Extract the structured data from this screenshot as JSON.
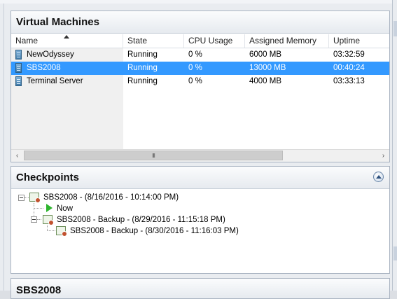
{
  "vm_panel": {
    "title": "Virtual Machines",
    "columns": [
      "Name",
      "State",
      "CPU Usage",
      "Assigned Memory",
      "Uptime"
    ],
    "sorted_column": "Name",
    "sort_direction": "ascending",
    "rows": [
      {
        "name": "NewOdyssey",
        "state": "Running",
        "cpu": "0 %",
        "memory": "6000 MB",
        "uptime": "03:32:59",
        "selected": false
      },
      {
        "name": "SBS2008",
        "state": "Running",
        "cpu": "0 %",
        "memory": "13000 MB",
        "uptime": "00:40:24",
        "selected": true
      },
      {
        "name": "Terminal Server",
        "state": "Running",
        "cpu": "0 %",
        "memory": "4000 MB",
        "uptime": "03:33:13",
        "selected": false
      }
    ],
    "scrollbar_grip": "III"
  },
  "checkpoints": {
    "title": "Checkpoints",
    "items": [
      {
        "label": "SBS2008 - (8/16/2016 - 10:14:00 PM)",
        "level": 0
      },
      {
        "label": "Now",
        "level": 1
      },
      {
        "label": "SBS2008 - Backup - (8/29/2016 - 11:15:18 PM)",
        "level": 1
      },
      {
        "label": "SBS2008 - Backup - (8/30/2016 - 11:16:03 PM)",
        "level": 2
      }
    ]
  },
  "details_panel": {
    "title": "SBS2008"
  },
  "colors": {
    "selection": "#3399ff",
    "play_green": "#2fb52f"
  }
}
